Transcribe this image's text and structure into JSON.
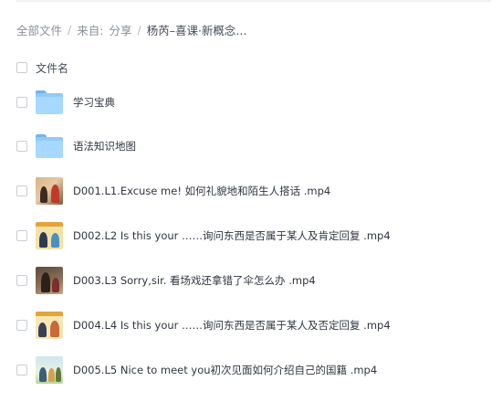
{
  "breadcrumb": {
    "all_files": "全部文件",
    "from_label": "来自:",
    "share": "分享",
    "current": "杨芮–喜课·新概念..."
  },
  "header": {
    "column_name": "文件名"
  },
  "files": [
    {
      "name": "学习宝典",
      "type": "folder",
      "icon": "folder-icon"
    },
    {
      "name": "语法知识地图",
      "type": "folder",
      "icon": "folder-icon"
    },
    {
      "name": "D001.L1.Excuse me! 如何礼貌地和陌生人搭话 .mp4",
      "type": "video",
      "icon": "video-thumbnail"
    },
    {
      "name": "D002.L2 Is this your ……询问东西是否属于某人及肯定回复 .mp4",
      "type": "video",
      "icon": "video-thumbnail"
    },
    {
      "name": "D003.L3 Sorry,sir. 看场戏还拿错了伞怎么办 .mp4",
      "type": "video",
      "icon": "video-thumbnail"
    },
    {
      "name": "D004.L4 Is this your ……询问东西是否属于某人及否定回复 .mp4",
      "type": "video",
      "icon": "video-thumbnail"
    },
    {
      "name": "D005.L5 Nice to meet you初次见面如何介绍自己的国籍 .mp4",
      "type": "video",
      "icon": "video-thumbnail"
    }
  ],
  "colors": {
    "folder": "#8ecbfb",
    "text_primary": "#303641",
    "text_secondary": "#8a8f99",
    "checkbox_border": "#c9cdd4"
  }
}
